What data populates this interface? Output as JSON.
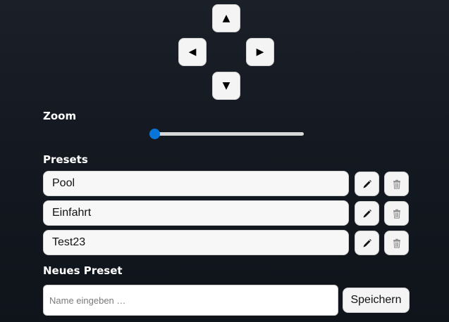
{
  "dpad": {
    "up": "▲",
    "left": "◀",
    "right": "▶",
    "down": "▼"
  },
  "zoom": {
    "label": "Zoom",
    "value": 0,
    "min": 0,
    "max": 1
  },
  "presets": {
    "label": "Presets",
    "items": [
      {
        "name": "Pool",
        "edit_icon": "pencil-icon",
        "delete_icon": "trash-icon"
      },
      {
        "name": "Einfahrt",
        "edit_icon": "pencil-icon",
        "delete_icon": "trash-icon"
      },
      {
        "name": "Test23",
        "edit_icon": "pencil-icon",
        "delete_icon": "trash-icon"
      }
    ]
  },
  "new_preset": {
    "label": "Neues Preset",
    "input_value": "",
    "input_placeholder": "Name eingeben …",
    "save_label": "Speichern"
  },
  "colors": {
    "accent": "#0a75d8",
    "background": "#141921",
    "button_bg": "#f4f4f4"
  }
}
